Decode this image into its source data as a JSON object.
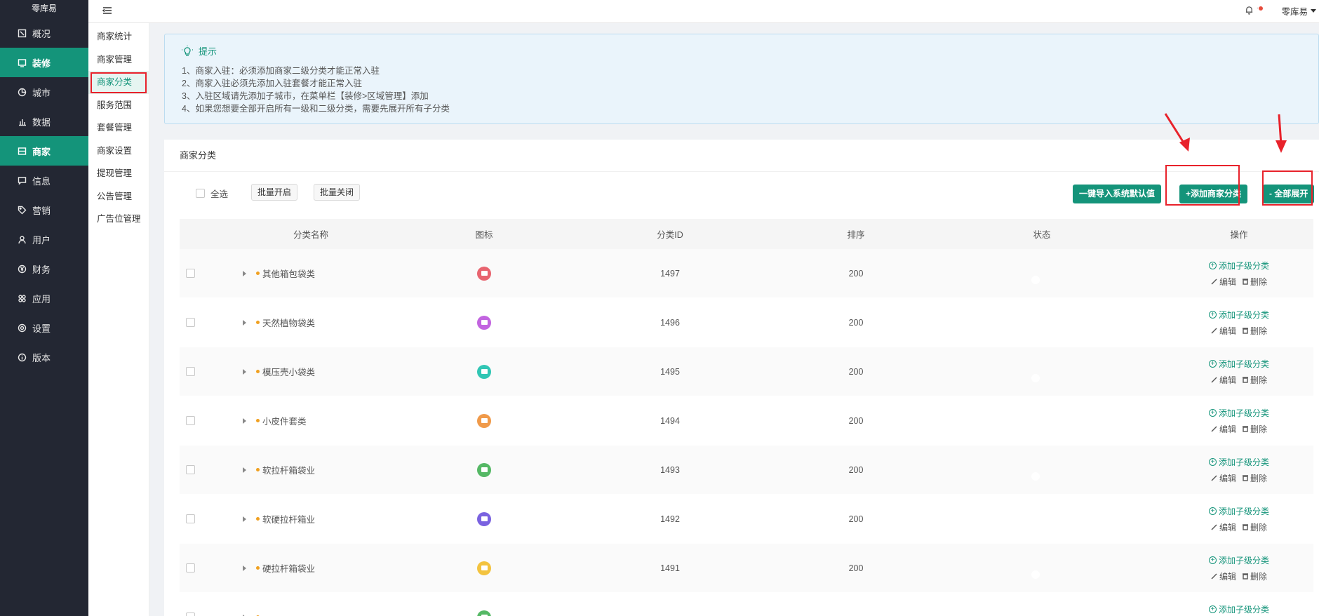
{
  "sidebar": {
    "brand": "零库易",
    "items": [
      {
        "label": "概况",
        "icon": "overview-icon",
        "active": false
      },
      {
        "label": "装修",
        "icon": "decorate-icon",
        "active": true
      },
      {
        "label": "城市",
        "icon": "city-icon",
        "active": false
      },
      {
        "label": "数据",
        "icon": "chart-icon",
        "active": false
      },
      {
        "label": "商家",
        "icon": "store-icon",
        "active": true
      },
      {
        "label": "信息",
        "icon": "message-icon",
        "active": false
      },
      {
        "label": "营销",
        "icon": "tag-icon",
        "active": false
      },
      {
        "label": "用户",
        "icon": "user-icon",
        "active": false
      },
      {
        "label": "财务",
        "icon": "yen-icon",
        "active": false
      },
      {
        "label": "应用",
        "icon": "apps-icon",
        "active": false
      },
      {
        "label": "设置",
        "icon": "gear-icon",
        "active": false
      },
      {
        "label": "版本",
        "icon": "info-icon",
        "active": false
      }
    ]
  },
  "submenu": {
    "items": [
      "商家统计",
      "商家管理",
      "商家分类",
      "服务范围",
      "套餐管理",
      "商家设置",
      "提现管理",
      "公告管理",
      "广告位管理"
    ],
    "active_index": 2
  },
  "topbar": {
    "user": "零库易",
    "separator": "·"
  },
  "tip": {
    "title": "提示",
    "lines": [
      "1、商家入驻：必须添加商家二级分类才能正常入驻",
      "2、商家入驻必须先添加入驻套餐才能正常入驻",
      "3、入驻区域请先添加子城市，在菜单栏【装修>区域管理】添加",
      "4、如果您想要全部开启所有一级和二级分类，需要先展开所有子分类"
    ]
  },
  "card": {
    "title": "商家分类",
    "select_all": "全选",
    "batch_enable": "批量开启",
    "batch_disable": "批量关闭",
    "import_default": "一键导入系统默认值",
    "add_category": "+添加商家分类",
    "expand_all": "- 全部展开"
  },
  "table": {
    "headers": {
      "name": "分类名称",
      "icon": "图标",
      "id": "分类ID",
      "sort": "排序",
      "status": "状态",
      "op": "操作"
    },
    "rows": [
      {
        "name": "其他箱包袋类",
        "id": "1497",
        "sort": "200",
        "icon_color": "#e8646f",
        "enabled": true
      },
      {
        "name": "天然植物袋类",
        "id": "1496",
        "sort": "200",
        "icon_color": "#c264e0",
        "enabled": true
      },
      {
        "name": "模压壳小袋类",
        "id": "1495",
        "sort": "200",
        "icon_color": "#31c6b4",
        "enabled": true
      },
      {
        "name": "小皮件套类",
        "id": "1494",
        "sort": "200",
        "icon_color": "#f09a4a",
        "enabled": true
      },
      {
        "name": "软拉杆箱袋业",
        "id": "1493",
        "sort": "200",
        "icon_color": "#55b865",
        "enabled": true
      },
      {
        "name": "软硬拉杆箱业",
        "id": "1492",
        "sort": "200",
        "icon_color": "#7a62e0",
        "enabled": true
      },
      {
        "name": "硬拉杆箱袋业",
        "id": "1491",
        "sort": "200",
        "icon_color": "#f3c33f",
        "enabled": true
      },
      {
        "name": "",
        "id": "",
        "sort": "",
        "icon_color": "#55b865",
        "enabled": true
      }
    ],
    "op_add": "添加子级分类",
    "op_edit": "编辑",
    "op_delete": "删除"
  },
  "colors": {
    "primary": "#14947a",
    "sidebar_bg": "#232733",
    "annotation_red": "#e8222b"
  }
}
